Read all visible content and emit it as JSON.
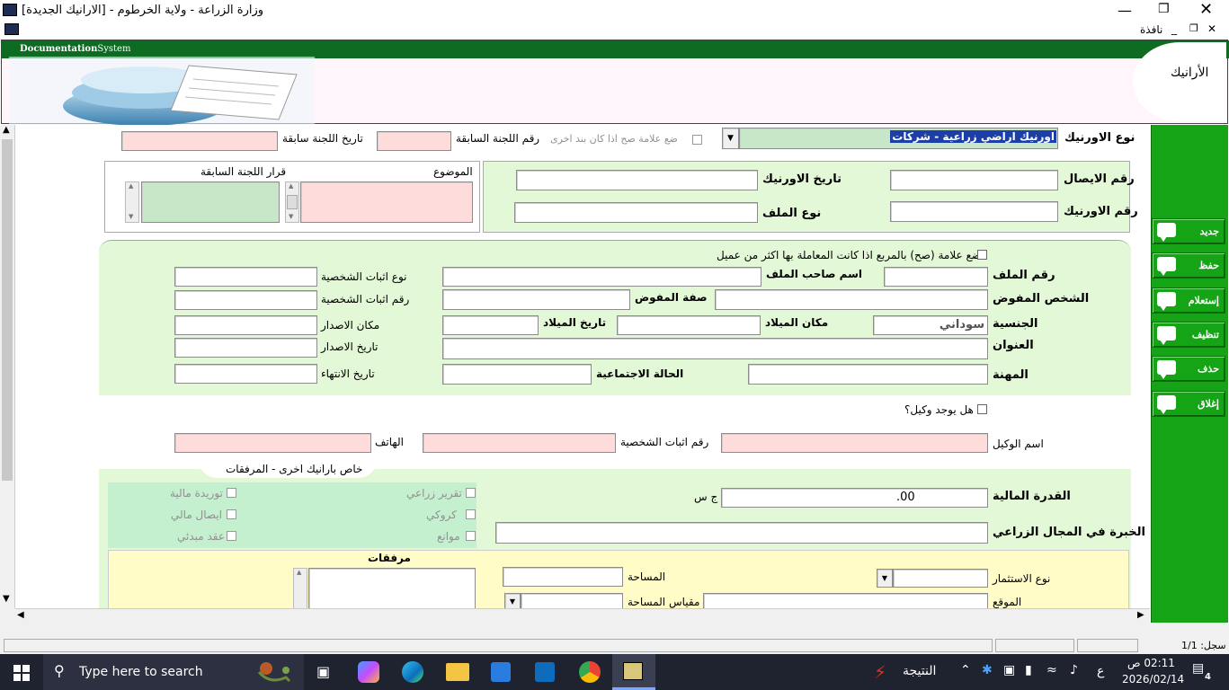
{
  "window": {
    "title": "وزارة الزراعة - ولاية الخرطوم - [الارانيك الجديدة]",
    "menu_window": "نافذة"
  },
  "banner": {
    "logo_text_bold": "Documentation",
    "logo_text_rest": "System",
    "section_title": "الأرانيك"
  },
  "top": {
    "form_type_label": "نوع الاورنيك",
    "form_type_value": "اورنيك اراضي زراعية - شركات",
    "other_item_checkbox": "ضع علامة صح اذا كان بند اخرى",
    "prev_committee_no_label": "رقم اللجنة السابقة",
    "prev_committee_date_label": "تاريخ اللجنة سابقة",
    "subject_label": "الموضوع",
    "prev_committee_decision_label": "قرار اللجنة السابقة",
    "receipt_no_label": "رقم الايصال",
    "form_date_label": "تاريخ الاورنيك",
    "form_no_label": "رقم الاورنيك",
    "file_type_label": "نوع الملف"
  },
  "person": {
    "multi_client_checkbox": "ضع علامة (صح) بالمربع اذا كانت المعاملة بها اكثر من عميل",
    "file_no_label": "رقم الملف",
    "file_owner_label": "اسم صاحب الملف",
    "id_type_label": "نوع اثبات الشخصية",
    "delegate_label": "الشخص المفوض",
    "delegate_role_label": "صفة المفوض",
    "id_no_label": "رقم اثبات الشخصية",
    "nationality_label": "الجنسية",
    "nationality_value": "سوداني",
    "birth_place_label": "مكان الميلاد",
    "birth_date_label": "تاريخ الميلاد",
    "issue_place_label": "مكان الاصدار",
    "address_label": "العنوان",
    "issue_date_label": "تاريخ الاصدار",
    "occupation_label": "المهنة",
    "marital_label": "الحالة الاجتماعية",
    "expiry_label": "تاريخ الانتهاء"
  },
  "agent": {
    "has_agent_checkbox": "هل يوجد وكيل؟",
    "agent_name_label": "اسم الوكيل",
    "agent_id_label": "رقم اثبات الشخصية",
    "phone_label": "الهاتف",
    "tab_label": "خاص بارانيك اخرى - المرفقات"
  },
  "attachments": {
    "financial_label": "القدرة المالية",
    "financial_value": ".00",
    "currency": "ج س",
    "experience_label": "الخبرة في المجال الزراعي",
    "checks": [
      "تقرير زراعي",
      "توريدة مالية",
      "كروكي",
      "ايصال مالي",
      "موانع",
      "عقد مبدئي"
    ],
    "attachments_title": "مرفقات",
    "area_label": "المساحة",
    "investment_type_label": "نوع الاستثمار",
    "area_unit_label": "مقياس المساحة",
    "location_label": "الموقع"
  },
  "sidebar_buttons": [
    "جديد",
    "حفظ",
    "إستعلام",
    "تنظيف",
    "حذف",
    "إغلاق"
  ],
  "status": {
    "record": "سجل: 1/1"
  },
  "taskbar": {
    "search_placeholder": "Type here to search",
    "result_label": "النتيجة",
    "lang": "ع",
    "time": "02:11 ص",
    "date": "2026/02/14",
    "notif_count": "4"
  },
  "colors": {
    "accent_green": "#15a415",
    "panel_green": "#e3f8d6",
    "pink_field": "#ffdcdc",
    "attachment_yellow": "#fffcc8"
  }
}
